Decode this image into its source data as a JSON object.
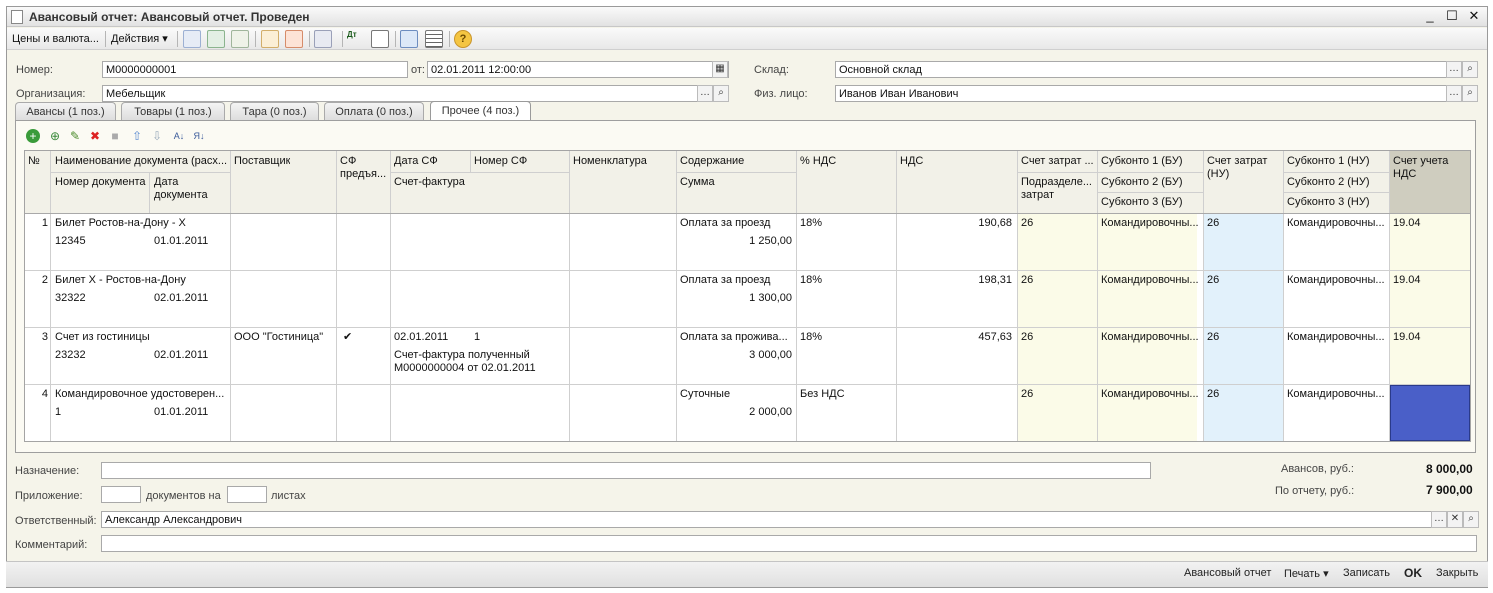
{
  "window": {
    "title": "Авансовый отчет: Авансовый отчет. Проведен",
    "minimize": "_",
    "maximize": "☐",
    "close": "✕"
  },
  "toolbar": {
    "prices": "Цены и валюта...",
    "actions": "Действия ▾"
  },
  "header": {
    "number_label": "Номер:",
    "number": "М0000000001",
    "date_label": "от:",
    "date": "02.01.2011 12:00:00",
    "org_label": "Организация:",
    "org": "Мебельщик",
    "warehouse_label": "Склад:",
    "warehouse": "Основной склад",
    "person_label": "Физ. лицо:",
    "person": "Иванов Иван Иванович"
  },
  "tabs": [
    "Авансы (1 поз.)",
    "Товары (1 поз.)",
    "Тара (0 поз.)",
    "Оплата (0 поз.)",
    "Прочее (4 поз.)"
  ],
  "columns": {
    "n": "№",
    "docname": "Наименование документа (расх...",
    "docnum": "Номер документа",
    "docdate": "Дата документа",
    "supplier": "Поставщик",
    "sf": "СФ предъя...",
    "sfdate": "Дата СФ",
    "sfnum": "Номер СФ",
    "invoice": "Счет-фактура",
    "nomen": "Номенклатура",
    "content": "Содержание",
    "sum": "Сумма",
    "vat_pct": "% НДС",
    "vat": "НДС",
    "acc": "Счет затрат ...",
    "dept": "Подразделе... затрат",
    "sub1": "Субконто 1 (БУ)",
    "sub2": "Субконто 2 (БУ)",
    "sub3": "Субконто 3 (БУ)",
    "acc_nu": "Счет затрат (НУ)",
    "subnu1": "Субконто 1 (НУ)",
    "subnu2": "Субконто 2 (НУ)",
    "subnu3": "Субконто 3 (НУ)",
    "vat_acc": "Счет учета НДС"
  },
  "rows": [
    {
      "n": "1",
      "docname": "Билет Ростов-на-Дону - Х",
      "docnum": "12345",
      "docdate": "01.01.2011",
      "supplier": "",
      "sf": "",
      "sfdate": "",
      "sfnum": "",
      "invoice": "",
      "content": "Оплата за проезд",
      "sum": "1 250,00",
      "vat_pct": "18%",
      "vat": "190,68",
      "acc": "26",
      "sub1": "Командировочны...",
      "acc_nu": "26",
      "subnu1": "Командировочны...",
      "vat_acc": "19.04"
    },
    {
      "n": "2",
      "docname": "Билет Х - Ростов-на-Дону",
      "docnum": "32322",
      "docdate": "02.01.2011",
      "supplier": "",
      "sf": "",
      "sfdate": "",
      "sfnum": "",
      "invoice": "",
      "content": "Оплата за проезд",
      "sum": "1 300,00",
      "vat_pct": "18%",
      "vat": "198,31",
      "acc": "26",
      "sub1": "Командировочны...",
      "acc_nu": "26",
      "subnu1": "Командировочны...",
      "vat_acc": "19.04"
    },
    {
      "n": "3",
      "docname": "Счет из гостиницы",
      "docnum": "23232",
      "docdate": "02.01.2011",
      "supplier": "ООО \"Гостиница\"",
      "sf": "✔",
      "sfdate": "02.01.2011",
      "sfnum": "1",
      "invoice": "Счет-фактура полученный М0000000004 от 02.01.2011",
      "content": "Оплата за прожива...",
      "sum": "3 000,00",
      "vat_pct": "18%",
      "vat": "457,63",
      "acc": "26",
      "sub1": "Командировочны...",
      "acc_nu": "26",
      "subnu1": "Командировочны...",
      "vat_acc": "19.04"
    },
    {
      "n": "4",
      "docname": "Командировочное удостоверен...",
      "docnum": "1",
      "docdate": "01.01.2011",
      "supplier": "",
      "sf": "",
      "sfdate": "",
      "sfnum": "",
      "invoice": "",
      "content": "Суточные",
      "sum": "2 000,00",
      "vat_pct": "Без НДС",
      "vat": "",
      "acc": "26",
      "sub1": "Командировочны...",
      "acc_nu": "26",
      "subnu1": "Командировочны...",
      "vat_acc": ""
    }
  ],
  "footer": {
    "purpose_label": "Назначение:",
    "purpose": "",
    "attach_label": "Приложение:",
    "docs_on": "документов на",
    "sheets": "листах",
    "resp_label": "Ответственный:",
    "resp": "Александр Александрович",
    "comment_label": "Комментарий:",
    "comment": "",
    "adv_label": "Авансов, руб.:",
    "adv": "8 000,00",
    "rep_label": "По отчету, руб.:",
    "rep": "7 900,00"
  },
  "bottom": {
    "report": "Авансовый отчет",
    "print": "Печать ▾",
    "save": "Записать",
    "ok": "OK",
    "close": "Закрыть"
  },
  "colors": {
    "selected_cell": "#4a5fc8",
    "nu_column": "#e2f1fb",
    "bu_column": "#fbfbe8"
  }
}
